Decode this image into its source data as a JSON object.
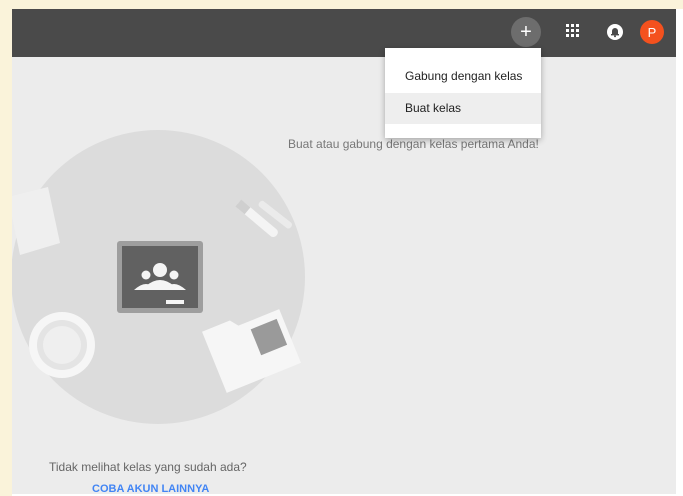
{
  "header": {
    "add_icon": "plus-icon",
    "apps_icon": "apps-grid-icon",
    "notifications_icon": "bell-icon",
    "avatar_initial": "P",
    "avatar_color": "#f4511e"
  },
  "menu": {
    "items": [
      {
        "label": "Gabung dengan kelas"
      },
      {
        "label": "Buat kelas"
      }
    ]
  },
  "main": {
    "empty_message": "Buat atau gabung dengan kelas pertama Anda!",
    "no_class_text": "Tidak melihat kelas yang sudah ada?",
    "try_other_account": "COBA AKUN LAINNYA"
  }
}
